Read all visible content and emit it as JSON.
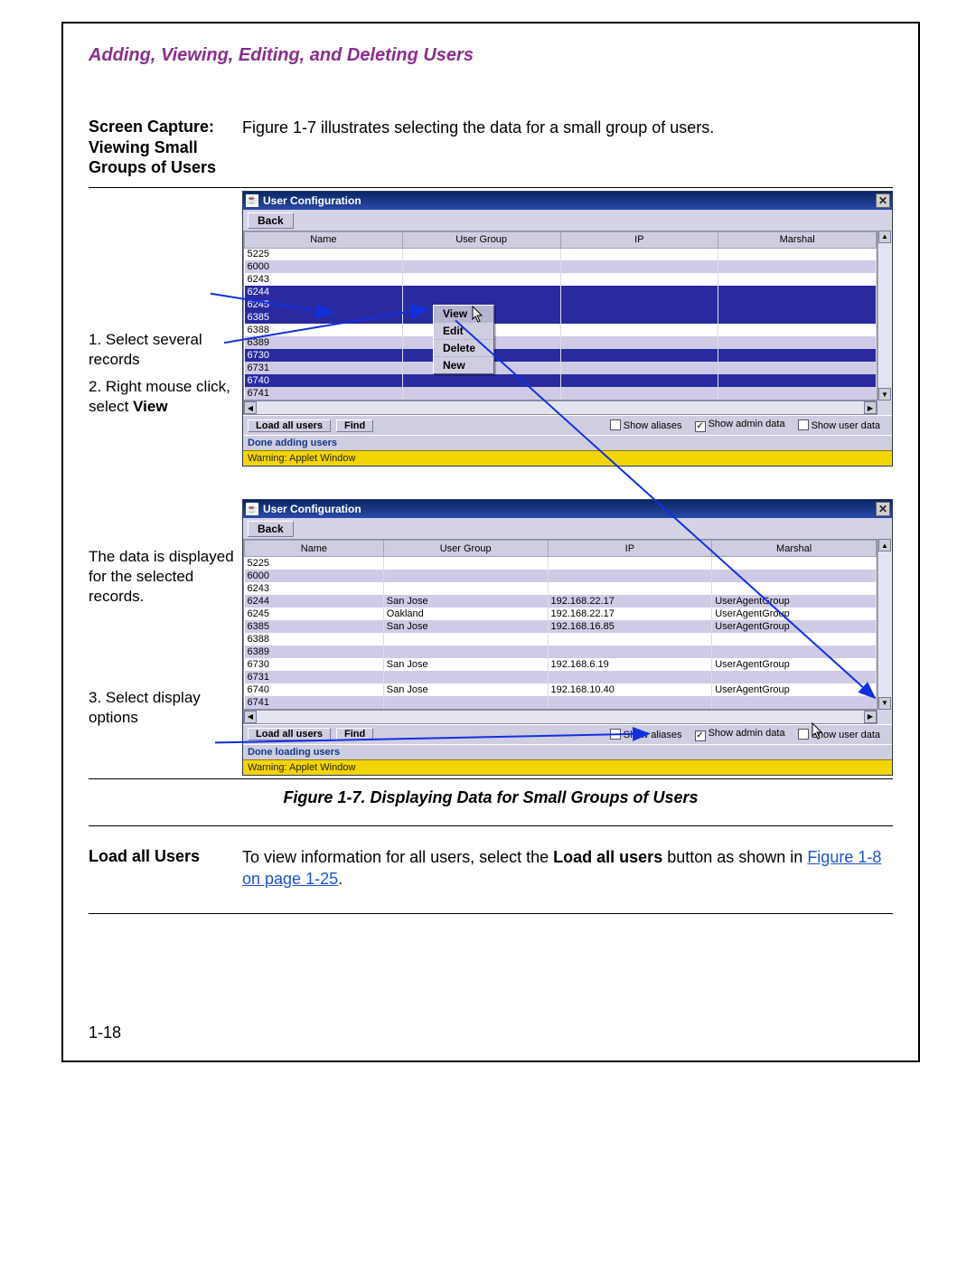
{
  "page": {
    "header": "Adding, Viewing, Editing, and Deleting Users",
    "page_number": "1-18"
  },
  "section1": {
    "left_heading": "Screen Capture: Viewing Small Groups of Users",
    "right_text": "Figure 1-7 illustrates selecting the data for a small group of users."
  },
  "annotations": {
    "top1": "1. Select several records",
    "top2_a": "2. Right mouse click, select ",
    "top2_b": "View",
    "mid": "The data is displayed for the selected records.",
    "bot": "3. Select display options"
  },
  "figure_caption": "Figure 1-7. Displaying Data for Small Groups of Users",
  "section2": {
    "left_heading": "Load all Users",
    "right_a": "To view information for all users, select the ",
    "right_b": "Load all users",
    "right_c": " button as shown in ",
    "link": "Figure 1-8 on page 1-25",
    "right_d": "."
  },
  "app": {
    "title": "User Configuration",
    "back": "Back",
    "columns": [
      "Name",
      "User Group",
      "IP",
      "Marshal"
    ],
    "load_all": "Load all users",
    "find": "Find",
    "show_aliases": "Show aliases",
    "show_admin": "Show admin data",
    "show_user": "Show user data",
    "applet_warn": "Warning: Applet Window"
  },
  "shot1": {
    "status": "Done adding users",
    "rows": [
      {
        "name": "5225",
        "ug": "",
        "ip": "",
        "m": "",
        "sel": false,
        "stripe": false
      },
      {
        "name": "6000",
        "ug": "",
        "ip": "",
        "m": "",
        "sel": false,
        "stripe": true
      },
      {
        "name": "6243",
        "ug": "",
        "ip": "",
        "m": "",
        "sel": false,
        "stripe": false
      },
      {
        "name": "6244",
        "ug": "",
        "ip": "",
        "m": "",
        "sel": true,
        "stripe": true
      },
      {
        "name": "6245",
        "ug": "",
        "ip": "",
        "m": "",
        "sel": true,
        "stripe": false
      },
      {
        "name": "6385",
        "ug": "",
        "ip": "",
        "m": "",
        "sel": true,
        "stripe": true
      },
      {
        "name": "6388",
        "ug": "",
        "ip": "",
        "m": "",
        "sel": false,
        "stripe": false
      },
      {
        "name": "6389",
        "ug": "",
        "ip": "",
        "m": "",
        "sel": false,
        "stripe": true
      },
      {
        "name": "6730",
        "ug": "",
        "ip": "",
        "m": "",
        "sel": true,
        "stripe": false
      },
      {
        "name": "6731",
        "ug": "",
        "ip": "",
        "m": "",
        "sel": false,
        "stripe": true
      },
      {
        "name": "6740",
        "ug": "",
        "ip": "",
        "m": "",
        "sel": true,
        "stripe": false
      },
      {
        "name": "6741",
        "ug": "",
        "ip": "",
        "m": "",
        "sel": false,
        "stripe": true
      }
    ],
    "menu": [
      "View",
      "Edit",
      "Delete",
      "New"
    ]
  },
  "shot2": {
    "status": "Done loading users",
    "rows": [
      {
        "name": "5225",
        "ug": "",
        "ip": "",
        "m": "",
        "stripe": false
      },
      {
        "name": "6000",
        "ug": "",
        "ip": "",
        "m": "",
        "stripe": true
      },
      {
        "name": "6243",
        "ug": "",
        "ip": "",
        "m": "",
        "stripe": false
      },
      {
        "name": "6244",
        "ug": "San Jose",
        "ip": "192.168.22.17",
        "m": "UserAgentGroup",
        "stripe": true
      },
      {
        "name": "6245",
        "ug": "Oakland",
        "ip": "192.168.22.17",
        "m": "UserAgentGroup",
        "stripe": false
      },
      {
        "name": "6385",
        "ug": "San Jose",
        "ip": "192.168.16.85",
        "m": "UserAgentGroup",
        "stripe": true
      },
      {
        "name": "6388",
        "ug": "",
        "ip": "",
        "m": "",
        "stripe": false
      },
      {
        "name": "6389",
        "ug": "",
        "ip": "",
        "m": "",
        "stripe": true
      },
      {
        "name": "6730",
        "ug": "San Jose",
        "ip": "192.168.6.19",
        "m": "UserAgentGroup",
        "stripe": false
      },
      {
        "name": "6731",
        "ug": "",
        "ip": "",
        "m": "",
        "stripe": true
      },
      {
        "name": "6740",
        "ug": "San Jose",
        "ip": "192.168.10.40",
        "m": "UserAgentGroup",
        "stripe": false
      },
      {
        "name": "6741",
        "ug": "",
        "ip": "",
        "m": "",
        "stripe": true
      }
    ]
  }
}
